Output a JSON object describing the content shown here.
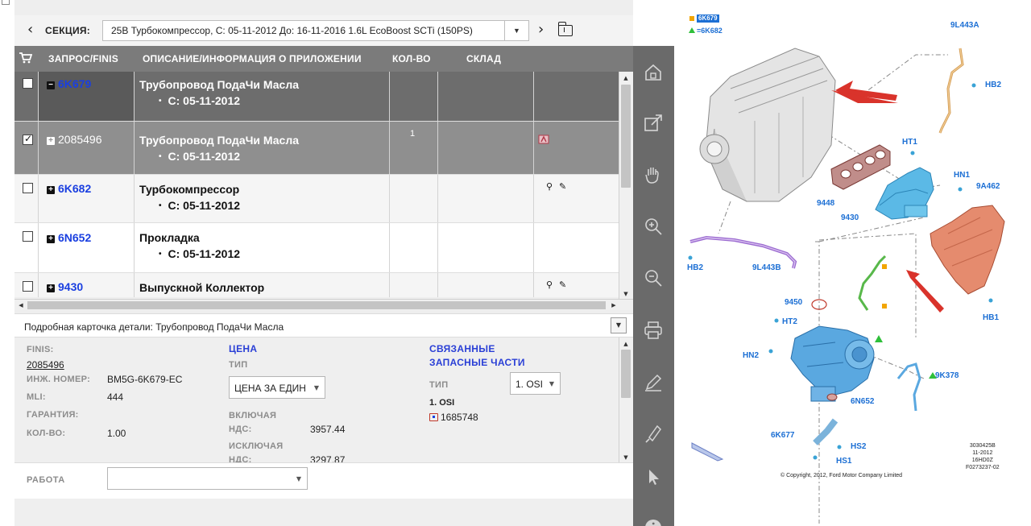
{
  "section": {
    "label": "СЕКЦИЯ:",
    "value": "25B Турбокомпрессор, С: 05-11-2012 До: 16-11-2016 1.6L EcoBoost SCTi (150PS)"
  },
  "table": {
    "columns": [
      "ЗАПРОС/FINIS",
      "ОПИСАНИЕ/ИНФОРМАЦИЯ О ПРИЛОЖЕНИИ",
      "КОЛ-ВО",
      "СКЛАД"
    ],
    "rows": [
      {
        "finis": "6K679",
        "description": "Трубопровод ПодаЧи Масла",
        "date": "С: 05-11-2012",
        "qty": "",
        "checked": false
      },
      {
        "finis": "2085496",
        "description": "Трубопровод ПодаЧи Масла",
        "date": "С: 05-11-2012",
        "qty": "1",
        "checked": true
      },
      {
        "finis": "6K682",
        "description": "Турбокомпрессор",
        "date": "С: 05-11-2012",
        "qty": "",
        "checked": false
      },
      {
        "finis": "6N652",
        "description": "Прокладка",
        "date": "С: 05-11-2012",
        "qty": "",
        "checked": false
      },
      {
        "finis": "9430",
        "description": "Выпускной Коллектор",
        "date": "",
        "qty": "",
        "checked": false
      }
    ]
  },
  "detail": {
    "title": "Подробная карточка детали: Трубопровод ПодаЧи Масла",
    "finis_label": "FINIS:",
    "finis_value": "2085496",
    "eng_no_label": "ИНЖ. НОМЕР:",
    "eng_no_value": "BM5G-6K679-EC",
    "mli_label": "MLI:",
    "mli_value": "444",
    "warranty_label": "ГАРАНТИЯ:",
    "qty_label": "КОЛ-ВО:",
    "qty_value": "1.00",
    "price": {
      "header": "ЦЕНА",
      "type_label": "ТИП",
      "type_value": "ЦЕНА ЗА ЕДИН",
      "incl_label_1": "ВКЛЮЧАЯ",
      "incl_label_2": "НДС:",
      "incl_value": "3957.44",
      "excl_label_1": "ИСКЛЮЧАЯ",
      "excl_label_2": "НДС:",
      "excl_value": "3297.87"
    },
    "related": {
      "header_1": "СВЯЗАННЫЕ",
      "header_2": "ЗАПАСНЫЕ ЧАСТИ",
      "type_label": "ТИП",
      "type_value": "1. OSI",
      "group": "1. OSI",
      "part": "1685748"
    },
    "work_label": "РАБОТА",
    "work_value": ""
  },
  "toolbar": {
    "icons": [
      "home-icon",
      "open-external-icon",
      "hand-pan-icon",
      "zoom-in-icon",
      "zoom-out-icon",
      "print-icon",
      "edit-pen-icon",
      "highlighter-icon",
      "pointer-icon",
      "info-icon"
    ]
  },
  "diagram": {
    "legend_top": "6K679",
    "legend_bottom": "=6K682",
    "labels": {
      "l_9L443A": "9L443A",
      "l_HB2_top": "HB2",
      "l_HT1": "HT1",
      "l_HN1": "HN1",
      "l_9A462": "9A462",
      "l_9448": "9448",
      "l_9430": "9430",
      "l_HB2_left": "HB2",
      "l_9L443B": "9L443B",
      "l_9450": "9450",
      "l_HT2": "HT2",
      "l_HB1": "HB1",
      "l_HN2": "HN2",
      "l_9K378": "9K378",
      "l_6N652": "6N652",
      "l_6K677": "6K677",
      "l_HS2": "HS2",
      "l_HS1": "HS1"
    },
    "copyright": "© Copyright, 2012, Ford Motor Company Limited",
    "ref_code": "3030425B\n11-2012\n16HD0Z\nF0273237-02"
  },
  "colors": {
    "header_gray": "#7b7b7b",
    "selected_dark": "#6d6d6d",
    "selected_mid": "#8f8f8f",
    "link_blue": "#1a3fe0",
    "diagram_label_blue": "#1c6fd4",
    "toolbar_gray": "#6a6a6a",
    "arrow_red": "#d9332b"
  }
}
